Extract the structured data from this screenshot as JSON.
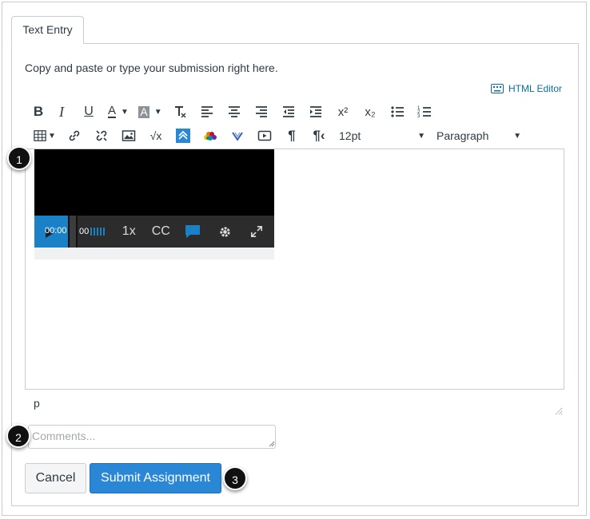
{
  "tab": {
    "label": "Text Entry"
  },
  "instructions": "Copy and paste or type your submission right here.",
  "html_editor": {
    "label": "HTML Editor",
    "icon": "keyboard-icon"
  },
  "toolbar": {
    "row1": [
      {
        "name": "bold-button",
        "glyph": "B"
      },
      {
        "name": "italic-button",
        "glyph": "I"
      },
      {
        "name": "underline-button",
        "glyph": "U"
      },
      {
        "name": "text-color-button",
        "glyph": "A"
      },
      {
        "name": "background-color-button",
        "glyph": "A"
      },
      {
        "name": "clear-formatting-button",
        "glyph": "T"
      },
      {
        "name": "align-left-button"
      },
      {
        "name": "align-center-button"
      },
      {
        "name": "align-right-button"
      },
      {
        "name": "outdent-button"
      },
      {
        "name": "indent-button"
      },
      {
        "name": "superscript-button",
        "glyph": "x²"
      },
      {
        "name": "subscript-button",
        "glyph": "x₂"
      },
      {
        "name": "bullet-list-button"
      },
      {
        "name": "numbered-list-button"
      }
    ],
    "font_size": "12pt",
    "block_format": "Paragraph"
  },
  "video": {
    "time_current": "00:00",
    "time_total": "00",
    "speed": "1x",
    "captions": "CC"
  },
  "editor_path": "p",
  "comments": {
    "placeholder": "Comments...",
    "value": ""
  },
  "buttons": {
    "cancel": "Cancel",
    "submit": "Submit Assignment"
  },
  "callouts": [
    "1",
    "2",
    "3"
  ],
  "colors": {
    "accent": "#2a87d6",
    "link": "#0770a3",
    "border": "#c7cdd1"
  }
}
